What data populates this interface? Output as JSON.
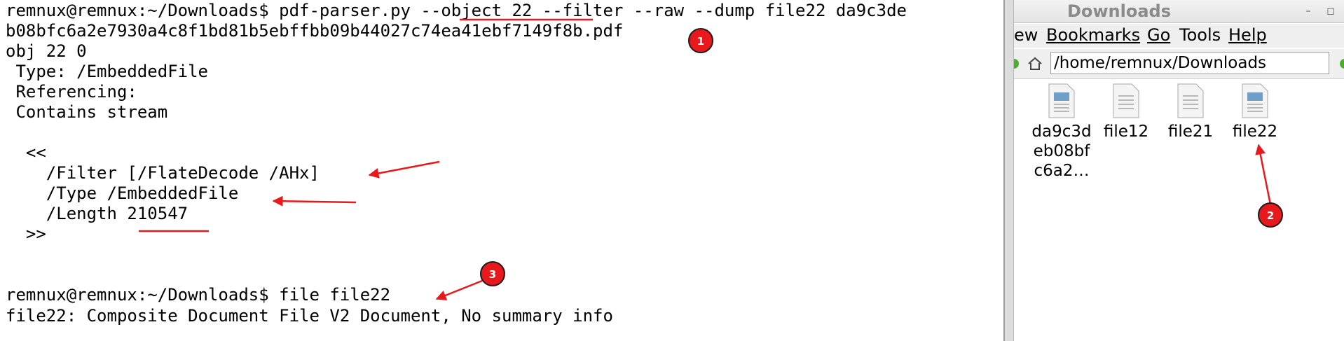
{
  "terminal": {
    "lines": [
      "remnux@remnux:~/Downloads$ pdf-parser.py --object 22 --filter --raw --dump file22 da9c3de",
      "b08bfc6a2e7930a4c8f1bd81b5ebffbb09b44027c74ea41ebf7149f8b.pdf",
      "obj 22 0",
      " Type: /EmbeddedFile",
      " Referencing:",
      " Contains stream",
      "",
      "  <<",
      "    /Filter [/FlateDecode /AHx]",
      "    /Type /EmbeddedFile",
      "    /Length 210547",
      "  >>",
      "",
      "",
      "remnux@remnux:~/Downloads$ file file22",
      "file22: Composite Document File V2 Document, No summary info"
    ]
  },
  "file_manager": {
    "title": "Downloads",
    "window_buttons": [
      "–",
      "◻"
    ],
    "menu": [
      "ew",
      "Bookmarks",
      "Go",
      "Tools",
      "Help"
    ],
    "path": "/home/remnux/Downloads",
    "files": [
      {
        "name": "da9c3d\neb08bf\nc6a2…",
        "icon": "image-document-icon"
      },
      {
        "name": "file12",
        "icon": "text-document-icon"
      },
      {
        "name": "file21",
        "icon": "text-document-icon"
      },
      {
        "name": "file22",
        "icon": "image-document-icon"
      }
    ]
  },
  "annotations": {
    "markers": [
      "1",
      "2",
      "3"
    ],
    "color": "#e8191c"
  }
}
